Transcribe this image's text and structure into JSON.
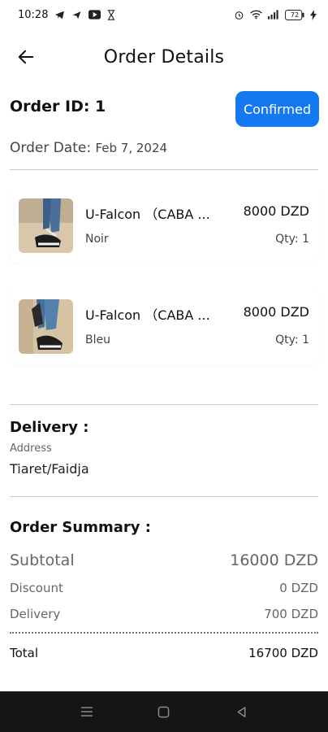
{
  "status_bar": {
    "time": "10:28",
    "battery": "72",
    "icons": [
      "telegram-icon",
      "send-icon",
      "youtube-icon",
      "hourglass-icon",
      "alarm-icon",
      "wifi-icon",
      "signal-icon",
      "battery-icon",
      "charging-icon"
    ]
  },
  "header": {
    "title": "Order Details",
    "back_icon": "arrow-left-icon"
  },
  "order": {
    "id_label": "Order ID: 1",
    "status": "Confirmed",
    "status_color": "#1479f0",
    "date_label": "Order Date:",
    "date_value": "Feb 7, 2024"
  },
  "items": [
    {
      "name": "U-Falcon （CABA ...",
      "price": "8000 DZD",
      "variant": "Noir",
      "qty": "Qty: 1"
    },
    {
      "name": "U-Falcon （CABA ...",
      "price": "8000 DZD",
      "variant": "Bleu",
      "qty": "Qty: 1"
    }
  ],
  "delivery": {
    "title": "Delivery :",
    "address_label": "Address",
    "address_value": "Tiaret/Faidja"
  },
  "summary": {
    "title": "Order Summary :",
    "subtotal_label": "Subtotal",
    "subtotal_value": "16000 DZD",
    "discount_label": "Discount",
    "discount_value": "0 DZD",
    "delivery_label": "Delivery",
    "delivery_value": "700 DZD",
    "total_label": "Total",
    "total_value": "16700 DZD"
  },
  "nav": {
    "icons": [
      "menu-icon",
      "home-square-icon",
      "back-triangle-icon"
    ]
  }
}
